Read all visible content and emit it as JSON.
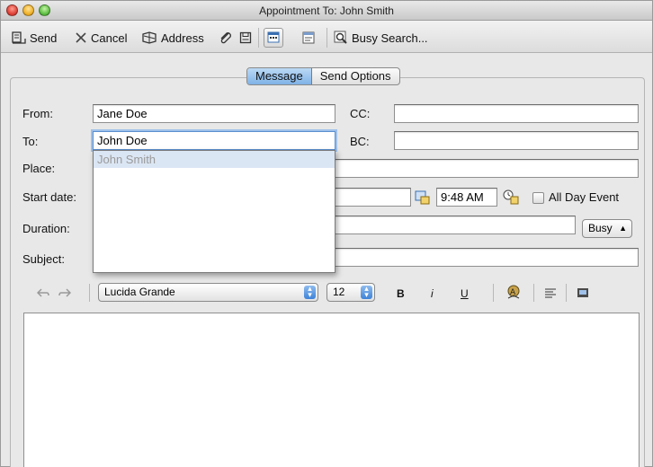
{
  "window": {
    "title": "Appointment To: John Smith"
  },
  "toolbar": {
    "send": "Send",
    "cancel": "Cancel",
    "address": "Address",
    "busy_search": "Busy Search..."
  },
  "tabs": [
    {
      "label": "Message",
      "active": true
    },
    {
      "label": "Send Options",
      "active": false
    }
  ],
  "form": {
    "from_label": "From:",
    "from_value": "Jane Doe",
    "cc_label": "CC:",
    "cc_value": "",
    "to_label": "To:",
    "to_value": "John Doe",
    "bc_label": "BC:",
    "bc_value": "",
    "place_label": "Place:",
    "place_value": "",
    "start_label": "Start date:",
    "start_time": "9:48 AM",
    "all_day_label": "All Day Event",
    "all_day_checked": false,
    "duration_label": "Duration:",
    "show_as": "Busy",
    "subject_label": "Subject:",
    "subject_value": ""
  },
  "autocomplete": {
    "items": [
      "John Smith"
    ]
  },
  "format": {
    "font": "Lucida Grande",
    "size": "12",
    "bold": "B",
    "italic": "i",
    "underline": "U"
  },
  "colors": {
    "accent": "#7fb2e6",
    "focus_ring": "#9fc1ea",
    "selection": "#dbe6f4"
  }
}
